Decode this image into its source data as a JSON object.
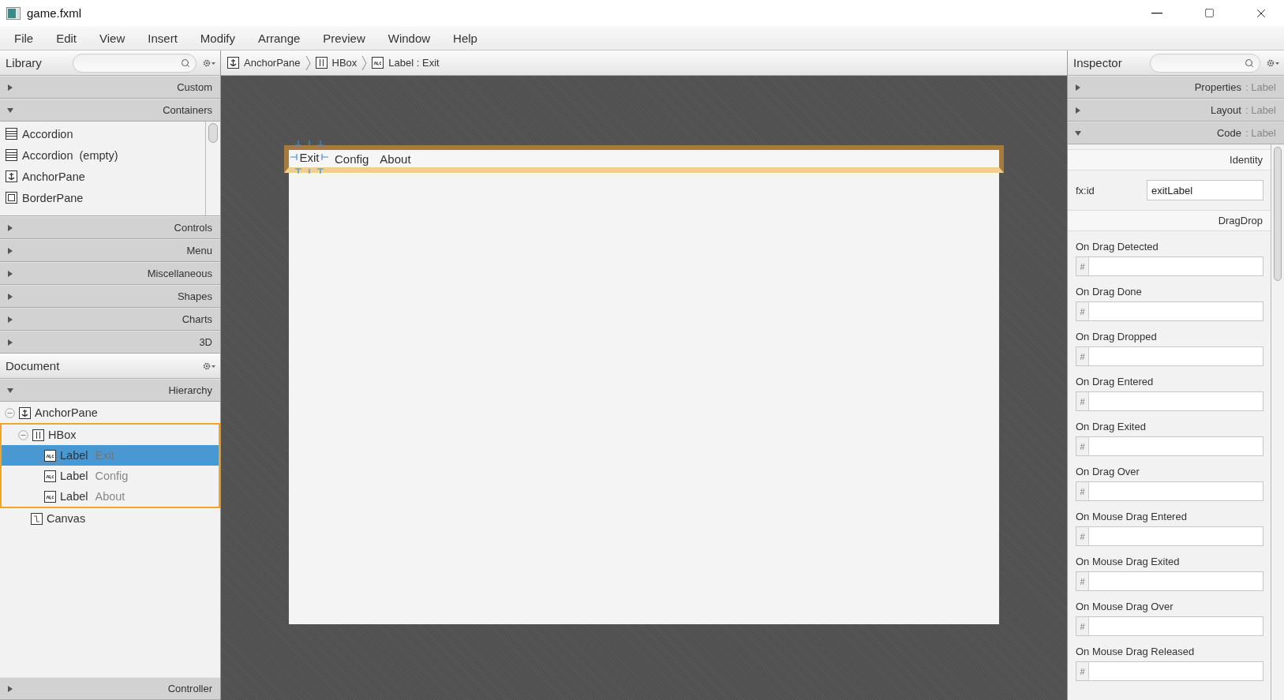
{
  "window": {
    "title": "game.fxml"
  },
  "menu_bar": [
    "File",
    "Edit",
    "View",
    "Insert",
    "Modify",
    "Arrange",
    "Preview",
    "Window",
    "Help"
  ],
  "library": {
    "title": "Library",
    "sections": [
      {
        "label": "Custom",
        "expanded": false
      },
      {
        "label": "Containers",
        "expanded": true,
        "items": [
          {
            "label": "Accordion",
            "kind": "accordion"
          },
          {
            "label": "Accordion  (empty)",
            "kind": "accordion"
          },
          {
            "label": "AnchorPane",
            "kind": "anchor"
          },
          {
            "label": "BorderPane",
            "kind": "border"
          }
        ]
      },
      {
        "label": "Controls",
        "expanded": false
      },
      {
        "label": "Menu",
        "expanded": false
      },
      {
        "label": "Miscellaneous",
        "expanded": false
      },
      {
        "label": "Shapes",
        "expanded": false
      },
      {
        "label": "Charts",
        "expanded": false
      },
      {
        "label": "3D",
        "expanded": false
      }
    ]
  },
  "document": {
    "title": "Document",
    "section": {
      "label": "Hierarchy",
      "expanded": true
    },
    "tree": [
      {
        "type": "AnchorPane",
        "kind": "anchor",
        "expanded": true,
        "selected": false,
        "highlighted": false,
        "children": [
          {
            "type": "HBox",
            "kind": "hbox",
            "expanded": true,
            "selected": false,
            "highlighted": true,
            "children": [
              {
                "type": "Label",
                "name": "Exit",
                "kind": "label",
                "selected": true,
                "highlighted": false
              },
              {
                "type": "Label",
                "name": "Config",
                "kind": "label",
                "selected": false,
                "highlighted": false
              },
              {
                "type": "Label",
                "name": "About",
                "kind": "label",
                "selected": false,
                "highlighted": false
              }
            ]
          },
          {
            "type": "Canvas",
            "kind": "canvas",
            "selected": false,
            "highlighted": false
          }
        ]
      }
    ]
  },
  "controller": {
    "label": "Controller",
    "expanded": false
  },
  "breadcrumb": [
    {
      "label": "AnchorPane",
      "kind": "anchor"
    },
    {
      "label": "HBox",
      "kind": "hbox"
    },
    {
      "label": "Label : Exit",
      "kind": "label"
    }
  ],
  "design": {
    "labels": [
      {
        "text": "Exit",
        "selected": true
      },
      {
        "text": "Config",
        "selected": false
      },
      {
        "text": "About",
        "selected": false
      }
    ]
  },
  "inspector": {
    "title": "Inspector",
    "sections": [
      {
        "label": "Properties",
        "target": ": Label",
        "expanded": false
      },
      {
        "label": "Layout",
        "target": ": Label",
        "expanded": false
      },
      {
        "label": "Code",
        "target": ": Label",
        "expanded": true
      }
    ],
    "identity_heading": "Identity",
    "fx_id": {
      "label": "fx:id",
      "value": "exitLabel"
    },
    "dragdrop_heading": "DragDrop",
    "events": [
      {
        "label": "On Drag Detected",
        "prefix": "#"
      },
      {
        "label": "On Drag Done",
        "prefix": "#"
      },
      {
        "label": "On Drag Dropped",
        "prefix": "#"
      },
      {
        "label": "On Drag Entered",
        "prefix": "#"
      },
      {
        "label": "On Drag Exited",
        "prefix": "#"
      },
      {
        "label": "On Drag Over",
        "prefix": "#"
      },
      {
        "label": "On Mouse Drag Entered",
        "prefix": "#"
      },
      {
        "label": "On Mouse Drag Exited",
        "prefix": "#"
      },
      {
        "label": "On Mouse Drag Over",
        "prefix": "#"
      },
      {
        "label": "On Mouse Drag Released",
        "prefix": "#"
      }
    ]
  }
}
